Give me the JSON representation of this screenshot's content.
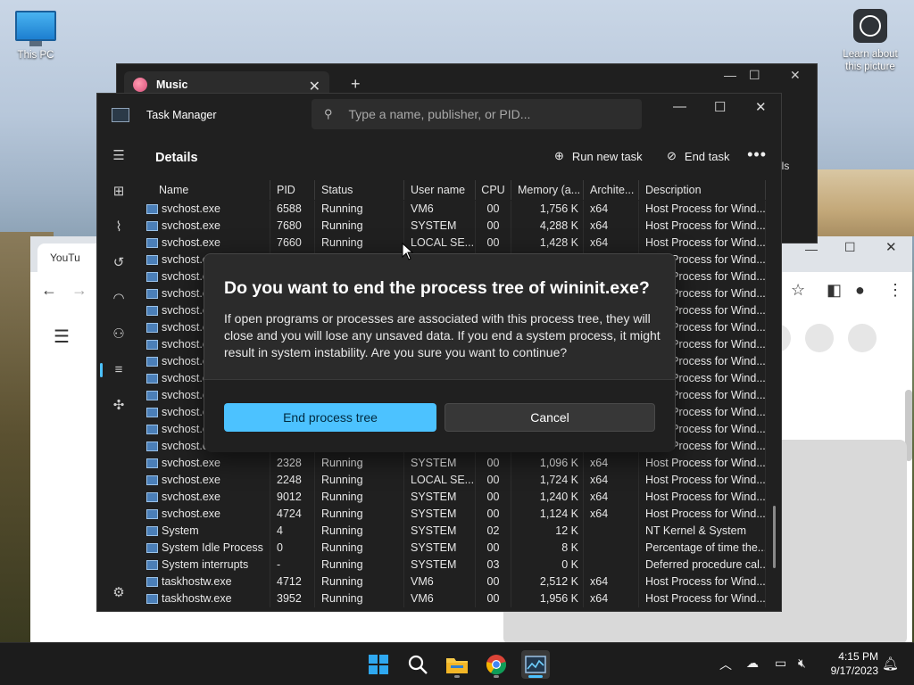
{
  "desktop": {
    "this_pc_label": "This PC",
    "learn_label_1": "Learn about",
    "learn_label_2": "this picture"
  },
  "music_window": {
    "tab_title": "Music",
    "close": "✕",
    "new_tab": "+"
  },
  "chrome_window": {
    "tab_title": "YouTu"
  },
  "task_manager": {
    "title": "Task Manager",
    "search_placeholder": "Type a name, publisher, or PID...",
    "page_title": "Details",
    "run_new_task": "Run new task",
    "end_task": "End task",
    "more": "•••",
    "behind_text": "ils",
    "columns": [
      "Name",
      "PID",
      "Status",
      "User name",
      "CPU",
      "Memory (a...",
      "Archite...",
      "Description"
    ],
    "rows": [
      [
        "svchost.exe",
        "6588",
        "Running",
        "VM6",
        "00",
        "1,756 K",
        "x64",
        "Host Process for Wind..."
      ],
      [
        "svchost.exe",
        "7680",
        "Running",
        "SYSTEM",
        "00",
        "4,288 K",
        "x64",
        "Host Process for Wind..."
      ],
      [
        "svchost.exe",
        "7660",
        "Running",
        "LOCAL SE...",
        "00",
        "1,428 K",
        "x64",
        "Host Process for Wind..."
      ],
      [
        "svchost.e",
        "",
        "",
        "",
        "",
        "",
        "",
        "Host Process for Wind..."
      ],
      [
        "svchost.e",
        "",
        "",
        "",
        "",
        "",
        "",
        "Host Process for Wind..."
      ],
      [
        "svchost.e",
        "",
        "",
        "",
        "",
        "",
        "",
        "Host Process for Wind..."
      ],
      [
        "svchost.e",
        "",
        "",
        "",
        "",
        "",
        "",
        "Host Process for Wind..."
      ],
      [
        "svchost.e",
        "",
        "",
        "",
        "",
        "",
        "",
        "Host Process for Wind..."
      ],
      [
        "svchost.e",
        "",
        "",
        "",
        "",
        "",
        "",
        "Host Process for Wind..."
      ],
      [
        "svchost.e",
        "",
        "",
        "",
        "",
        "",
        "",
        "Host Process for Wind..."
      ],
      [
        "svchost.e",
        "",
        "",
        "",
        "",
        "",
        "",
        "Host Process for Wind..."
      ],
      [
        "svchost.e",
        "",
        "",
        "",
        "",
        "",
        "",
        "Host Process for Wind..."
      ],
      [
        "svchost.e",
        "",
        "",
        "",
        "",
        "",
        "",
        "Host Process for Wind..."
      ],
      [
        "svchost.e",
        "",
        "",
        "",
        "",
        "",
        "",
        "Host Process for Wind..."
      ],
      [
        "svchost.e",
        "",
        "",
        "",
        "",
        "",
        "",
        "Host Process for Wind..."
      ],
      [
        "svchost.exe",
        "2328",
        "Running",
        "SYSTEM",
        "00",
        "1,096 K",
        "x64",
        "Host Process for Wind..."
      ],
      [
        "svchost.exe",
        "2248",
        "Running",
        "LOCAL SE...",
        "00",
        "1,724 K",
        "x64",
        "Host Process for Wind..."
      ],
      [
        "svchost.exe",
        "9012",
        "Running",
        "SYSTEM",
        "00",
        "1,240 K",
        "x64",
        "Host Process for Wind..."
      ],
      [
        "svchost.exe",
        "4724",
        "Running",
        "SYSTEM",
        "00",
        "1,124 K",
        "x64",
        "Host Process for Wind..."
      ],
      [
        "System",
        "4",
        "Running",
        "SYSTEM",
        "02",
        "12 K",
        "",
        "NT Kernel & System"
      ],
      [
        "System Idle Process",
        "0",
        "Running",
        "SYSTEM",
        "00",
        "8 K",
        "",
        "Percentage of time the..."
      ],
      [
        "System interrupts",
        "-",
        "Running",
        "SYSTEM",
        "03",
        "0 K",
        "",
        "Deferred procedure cal..."
      ],
      [
        "taskhostw.exe",
        "4712",
        "Running",
        "VM6",
        "00",
        "2,512 K",
        "x64",
        "Host Process for Wind..."
      ],
      [
        "taskhostw.exe",
        "3952",
        "Running",
        "VM6",
        "00",
        "1,956 K",
        "x64",
        "Host Process for Wind..."
      ]
    ]
  },
  "dialog": {
    "title": "Do you want to end the process tree of wininit.exe?",
    "body": "If open programs or processes are associated with this process tree, they will close and you will lose any unsaved data. If you end a system process, it might result in system instability. Are you sure you want to continue?",
    "primary": "End process tree",
    "cancel": "Cancel"
  },
  "taskbar": {
    "time": "4:15 PM",
    "date": "9/17/2023"
  },
  "colors": {
    "accent": "#4cc2ff",
    "window_bg": "#202020",
    "dialog_bg": "#2b2b2b"
  }
}
